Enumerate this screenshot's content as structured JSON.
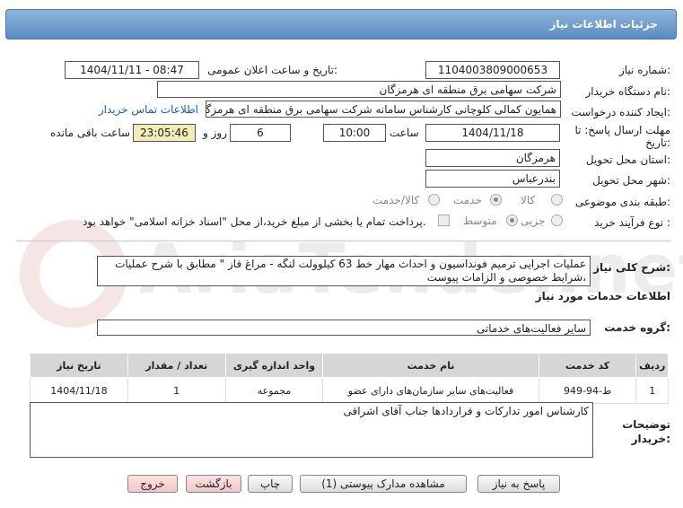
{
  "header": {
    "title": "جزئیات اطلاعات نیاز"
  },
  "form": {
    "need_number_label": "شماره نیاز:",
    "need_number": "1104003809000653",
    "announce_label": "تاریخ و ساعت اعلان عمومی:",
    "announce_value": "1404/11/11 - 08:47",
    "buyer_org_label": "نام دستگاه خریدار:",
    "buyer_org": "شرکت سهامی برق منطقه ای هرمزگان",
    "creator_label": "ایجاد کننده درخواست:",
    "creator": "همایون کمالی کلوچانی کارشناس سامانه شرکت سهامی برق منطقه ای هرمزگان",
    "contact_link": "اطلاعات تماس خریدار",
    "deadline_label": "مهلت ارسال پاسخ: تا تاریخ:",
    "deadline_date": "1404/11/18",
    "time_label": "ساعت",
    "deadline_time": "10:00",
    "days_value": "6",
    "days_label": "روز و",
    "remaining_time": "23:05:46",
    "remaining_label": "ساعت باقی مانده",
    "province_label": "استان محل تحویل:",
    "province": "هرمزگان",
    "city_label": "شهر محل تحویل:",
    "city": "بندرعباس",
    "category_label": "طبقه بندی موضوعی:",
    "category_options": [
      "کالا",
      "خدمت",
      "کالا/خدمت"
    ],
    "category_selected": "خدمت",
    "process_label": "نوع فرآیند خرید :",
    "process_options": [
      "جزیی",
      "متوسط"
    ],
    "process_selected": "متوسط",
    "payment_text": "پرداخت تمام یا بخشی از مبلغ خرید،از محل \"اسناد خزانه اسلامی\" خواهد بود."
  },
  "description": {
    "label": "شرح کلی نیاز:",
    "text": "عملیات اجرایی ترمیم فونداسیون و احداث مهار خط 63 کیلوولت لنگه - مراغ فاز \" مطابق با شرح عملیات ،شرایط خصوصی و الزامات پیوست"
  },
  "services": {
    "section_title": "اطلاعات خدمات مورد نیاز",
    "group_label": "گروه خدمت:",
    "group_value": "سایر فعالیت‌های خدماتی",
    "columns": [
      "ردیف",
      "کد خدمت",
      "نام خدمت",
      "واحد اندازه گیری",
      "تعداد / مقدار",
      "تاریخ نیاز"
    ],
    "rows": [
      [
        "1",
        "ط-94-949",
        "فعالیت‌های سایر سازمان‌های دارای عضو",
        "مجموعه",
        "1",
        "1404/11/18"
      ]
    ]
  },
  "buyer_notes": {
    "label": "توضیحات خریدار:",
    "text": "کارشناس امور تدارکات و قراردادها جناب آقای اشراقی"
  },
  "buttons": {
    "reply": "پاسخ به نیاز",
    "view_docs": "مشاهده مدارک پیوستی (1)",
    "print": "چاپ",
    "back": "بازگشت",
    "exit": "خروج"
  },
  "watermark": "AriaTender.net",
  "colors": {
    "title_bar": "#6f9dcc",
    "remaining_bg": "#f3ecb6",
    "link": "#1a5fb4"
  }
}
